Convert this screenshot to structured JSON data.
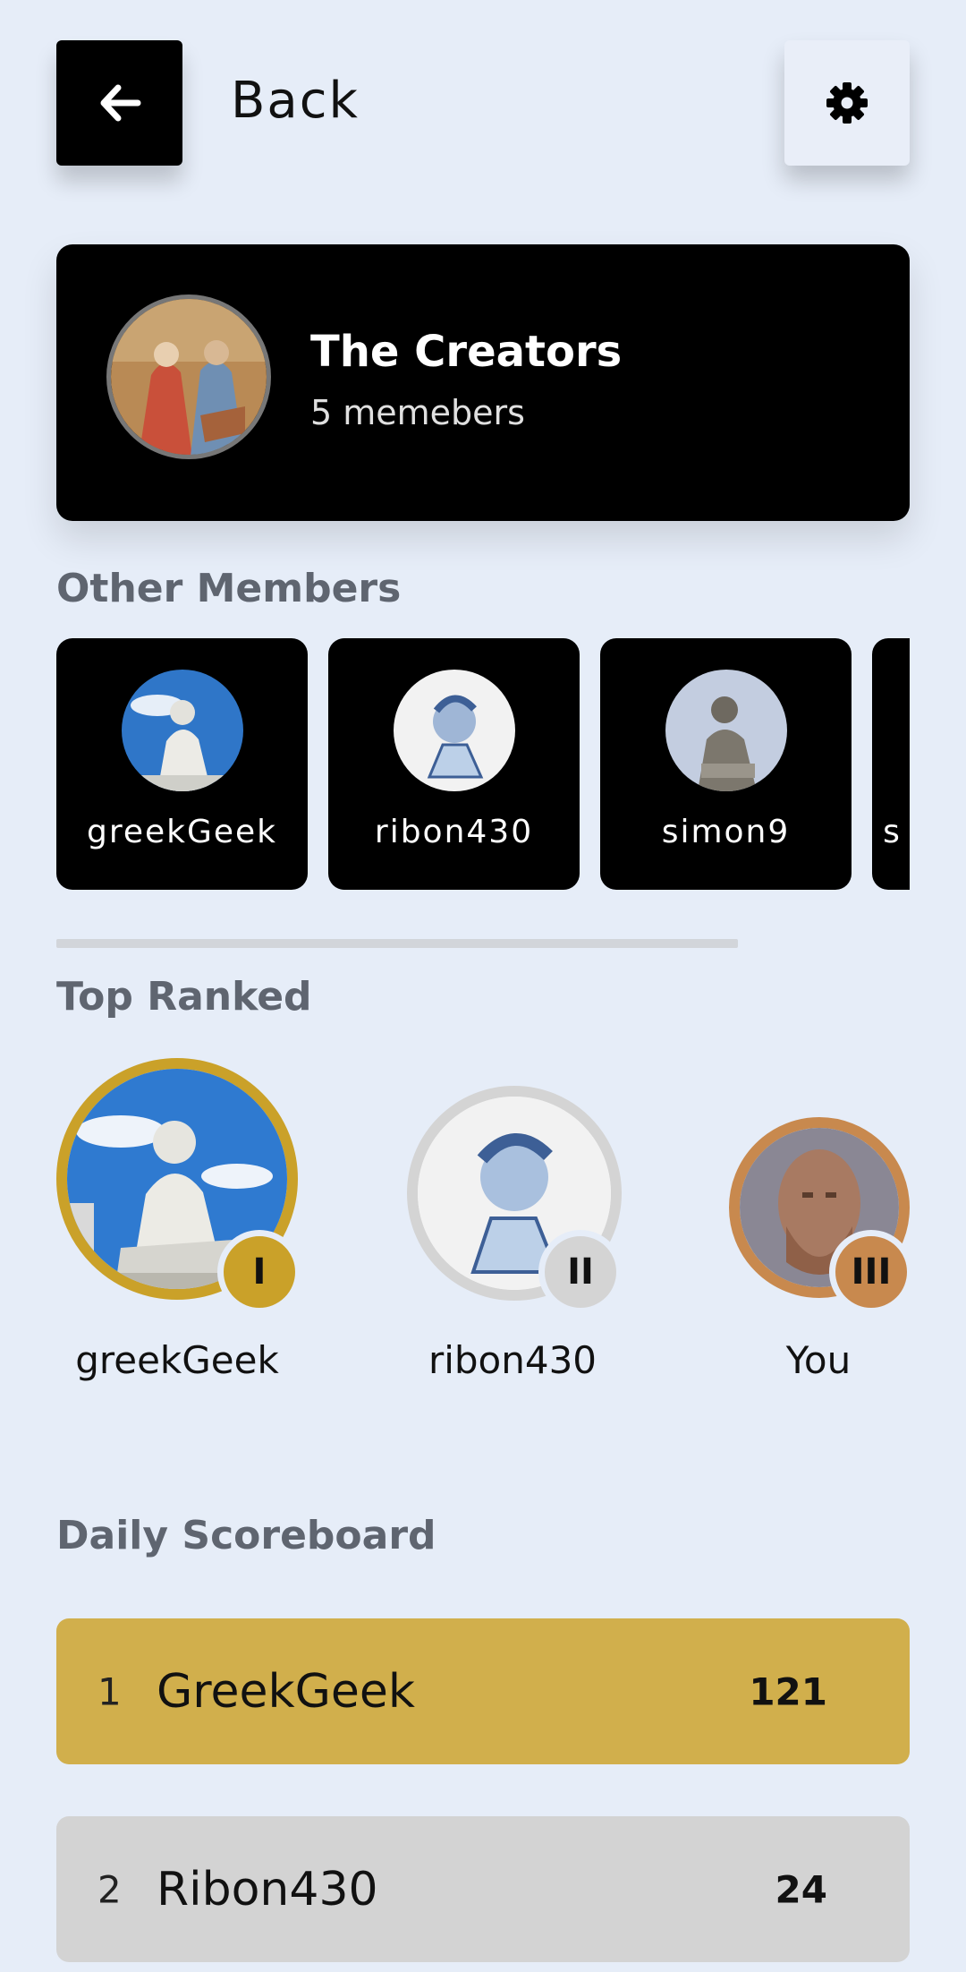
{
  "header": {
    "back_label": "Back"
  },
  "group": {
    "name": "The Creators",
    "members_count": "5 memebers"
  },
  "other_members": {
    "title": "Other Members",
    "items": [
      {
        "name": "greekGeek"
      },
      {
        "name": "ribon430"
      },
      {
        "name": "simon9"
      },
      {
        "name": "s"
      }
    ]
  },
  "top_ranked": {
    "title": "Top Ranked",
    "items": [
      {
        "name": "greekGeek",
        "badge": "I",
        "color": "#caa129"
      },
      {
        "name": "ribon430",
        "badge": "II",
        "color": "#d4d4d4"
      },
      {
        "name": "You",
        "badge": "III",
        "color": "#c8894e"
      }
    ]
  },
  "scoreboard": {
    "title": "Daily Scoreboard",
    "rows": [
      {
        "rank": "1",
        "name": "GreekGeek",
        "score": "121",
        "color": "#d1af4c"
      },
      {
        "rank": "2",
        "name": "Ribon430",
        "score": "24",
        "color": "#d3d3d3"
      }
    ]
  }
}
